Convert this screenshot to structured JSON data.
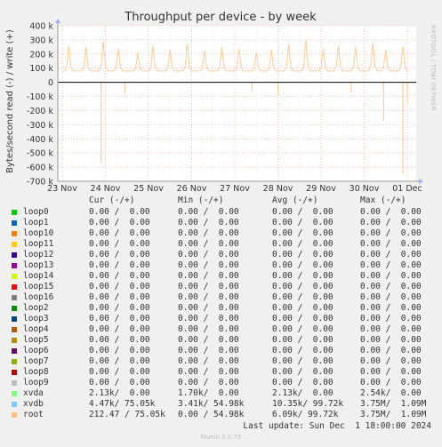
{
  "chart_data": {
    "type": "line",
    "title": "Throughput per device - by week",
    "ylabel": "Bytes/second read (-) / write (+)",
    "side_label": "RRDTOOL / TOBI OETIKER",
    "x_ticks": [
      "23 Nov",
      "24 Nov",
      "25 Nov",
      "26 Nov",
      "27 Nov",
      "28 Nov",
      "29 Nov",
      "30 Nov",
      "01 Dec"
    ],
    "y_ticks": [
      "400 k",
      "300 k",
      "200 k",
      "100 k",
      "0",
      "-100 k",
      "-200 k",
      "-300 k",
      "-400 k",
      "-500 k",
      "-600 k",
      "-700 k"
    ],
    "ylim": [
      -700000,
      400000
    ],
    "grid": true,
    "series": [
      {
        "name": "root",
        "color": "#ffcc99",
        "write_spikes_day": [
          0.15,
          0.55,
          0.95,
          1.3,
          1.75,
          2.1,
          2.5,
          2.9,
          3.3,
          3.7,
          4.1,
          4.5,
          4.85,
          5.25,
          5.65,
          6.05,
          6.4,
          6.8,
          7.2,
          7.5,
          7.9
        ],
        "write_spikes_value": [
          260000,
          250000,
          290000,
          240000,
          210000,
          260000,
          230000,
          270000,
          220000,
          250000,
          240000,
          210000,
          230000,
          270000,
          300000,
          240000,
          260000,
          250000,
          280000,
          230000,
          260000
        ],
        "read_spikes_day": [
          0.9,
          1.45,
          4.4,
          5.0,
          6.7,
          7.45,
          7.9,
          8.0
        ],
        "read_spikes_value": [
          -570000,
          -80000,
          -60000,
          -90000,
          -70000,
          -270000,
          -650000,
          -150000
        ]
      },
      {
        "name": "xvdb",
        "color": "#66b3ff",
        "write_spikes_day": [],
        "write_spikes_value": [],
        "read_spikes_day": [],
        "read_spikes_value": []
      }
    ],
    "legend": {
      "headers": [
        "Cur (-/+)",
        "Min (-/+)",
        "Avg (-/+)",
        "Max (-/+)"
      ],
      "rows": [
        {
          "name": "loop0",
          "color": "#00cc00",
          "cur": "0.00 /  0.00",
          "min": "0.00 /  0.00",
          "avg": "0.00 /  0.00",
          "max": "0.00 /  0.00"
        },
        {
          "name": "loop1",
          "color": "#0066b3",
          "cur": "0.00 /  0.00",
          "min": "0.00 /  0.00",
          "avg": "0.00 /  0.00",
          "max": "0.00 /  0.00"
        },
        {
          "name": "loop10",
          "color": "#ff8000",
          "cur": "0.00 /  0.00",
          "min": "0.00 /  0.00",
          "avg": "0.00 /  0.00",
          "max": "0.00 /  0.00"
        },
        {
          "name": "loop11",
          "color": "#ffcc00",
          "cur": "0.00 /  0.00",
          "min": "0.00 /  0.00",
          "avg": "0.00 /  0.00",
          "max": "0.00 /  0.00"
        },
        {
          "name": "loop12",
          "color": "#330099",
          "cur": "0.00 /  0.00",
          "min": "0.00 /  0.00",
          "avg": "0.00 /  0.00",
          "max": "0.00 /  0.00"
        },
        {
          "name": "loop13",
          "color": "#990099",
          "cur": "0.00 /  0.00",
          "min": "0.00 /  0.00",
          "avg": "0.00 /  0.00",
          "max": "0.00 /  0.00"
        },
        {
          "name": "loop14",
          "color": "#ccff00",
          "cur": "0.00 /  0.00",
          "min": "0.00 /  0.00",
          "avg": "0.00 /  0.00",
          "max": "0.00 /  0.00"
        },
        {
          "name": "loop15",
          "color": "#ff0000",
          "cur": "0.00 /  0.00",
          "min": "0.00 /  0.00",
          "avg": "0.00 /  0.00",
          "max": "0.00 /  0.00"
        },
        {
          "name": "loop16",
          "color": "#808080",
          "cur": "0.00 /  0.00",
          "min": "0.00 /  0.00",
          "avg": "0.00 /  0.00",
          "max": "0.00 /  0.00"
        },
        {
          "name": "loop2",
          "color": "#008f00",
          "cur": "0.00 /  0.00",
          "min": "0.00 /  0.00",
          "avg": "0.00 /  0.00",
          "max": "0.00 /  0.00"
        },
        {
          "name": "loop3",
          "color": "#00487d",
          "cur": "0.00 /  0.00",
          "min": "0.00 /  0.00",
          "avg": "0.00 /  0.00",
          "max": "0.00 /  0.00"
        },
        {
          "name": "loop4",
          "color": "#b35a00",
          "cur": "0.00 /  0.00",
          "min": "0.00 /  0.00",
          "avg": "0.00 /  0.00",
          "max": "0.00 /  0.00"
        },
        {
          "name": "loop5",
          "color": "#b38f00",
          "cur": "0.00 /  0.00",
          "min": "0.00 /  0.00",
          "avg": "0.00 /  0.00",
          "max": "0.00 /  0.00"
        },
        {
          "name": "loop6",
          "color": "#6b006b",
          "cur": "0.00 /  0.00",
          "min": "0.00 /  0.00",
          "avg": "0.00 /  0.00",
          "max": "0.00 /  0.00"
        },
        {
          "name": "loop7",
          "color": "#8fb300",
          "cur": "0.00 /  0.00",
          "min": "0.00 /  0.00",
          "avg": "0.00 /  0.00",
          "max": "0.00 /  0.00"
        },
        {
          "name": "loop8",
          "color": "#b30000",
          "cur": "0.00 /  0.00",
          "min": "0.00 /  0.00",
          "avg": "0.00 /  0.00",
          "max": "0.00 /  0.00"
        },
        {
          "name": "loop9",
          "color": "#bebebe",
          "cur": "0.00 /  0.00",
          "min": "0.00 /  0.00",
          "avg": "0.00 /  0.00",
          "max": "0.00 /  0.00"
        },
        {
          "name": "xvda",
          "color": "#80ff80",
          "cur": "2.13k/  0.00",
          "min": "1.70k/  0.00",
          "avg": "2.13k/  0.00",
          "max": "2.54k/  0.00"
        },
        {
          "name": "xvdb",
          "color": "#80c9ff",
          "cur": "4.47k/ 75.05k",
          "min": "3.41k/ 54.98k",
          "avg": "10.35k/ 99.72k",
          "max": "3.75M/  1.09M"
        },
        {
          "name": "root",
          "color": "#ffc080",
          "cur": "212.47 / 75.05k",
          "min": "0.00 / 54.98k",
          "avg": "6.09k/ 99.72k",
          "max": "3.75M/  1.09M"
        }
      ]
    }
  },
  "footer": {
    "last_update": "Last update: Sun Dec  1 18:00:00 2024",
    "munin": "Munin 2.0.75"
  }
}
